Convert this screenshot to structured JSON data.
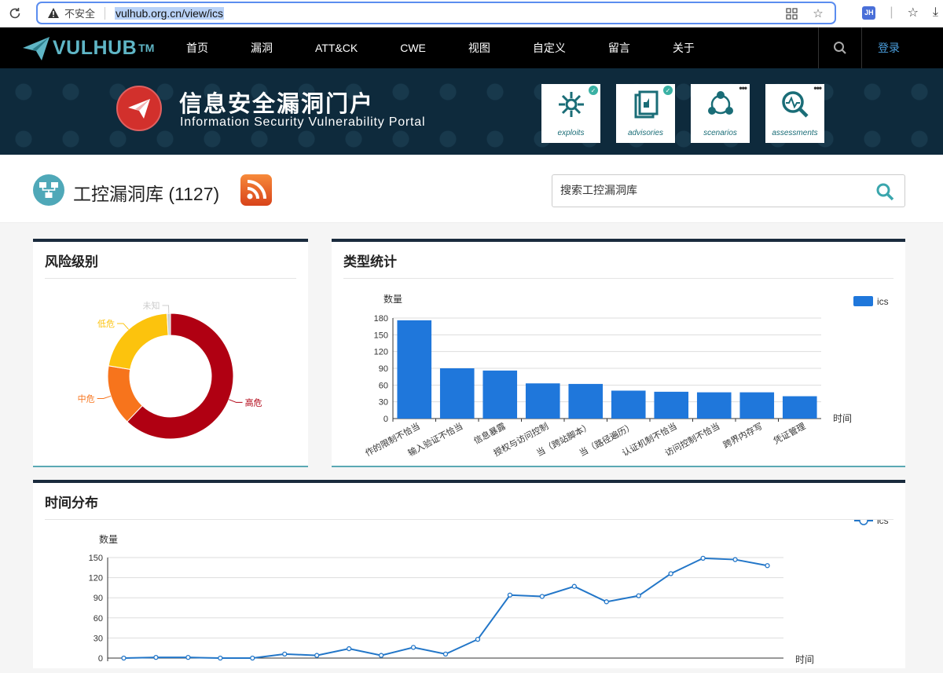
{
  "browser": {
    "insecure_label": "不安全",
    "url": "vulhub.org.cn/view/ics",
    "profile_badge": "JH"
  },
  "nav": {
    "logo_text": "VULHUB",
    "logo_tm": "TM",
    "items": [
      "首页",
      "漏洞",
      "ATT&CK",
      "CWE",
      "视图",
      "自定义",
      "留言",
      "关于"
    ],
    "login": "登录"
  },
  "banner": {
    "title_cn": "信息安全漏洞门户",
    "title_en": "Information Security Vulnerability Portal",
    "tiles": [
      {
        "label": "exploits",
        "badge": "check"
      },
      {
        "label": "advisories",
        "badge": "check"
      },
      {
        "label": "scenarios",
        "badge": "more"
      },
      {
        "label": "assessments",
        "badge": "more"
      }
    ]
  },
  "page": {
    "title": "工控漏洞库 (1127)",
    "search_placeholder": "搜索工控漏洞库"
  },
  "panels": {
    "risk_title": "风险级别",
    "type_title": "类型统计",
    "time_title": "时间分布"
  },
  "colors": {
    "high": "#b00012",
    "medium": "#f7741c",
    "low": "#fcc30d",
    "unknown": "#cccccc",
    "bar": "#1f77db",
    "line": "#2276c8"
  },
  "chart_data": [
    {
      "type": "pie",
      "title": "风险级别",
      "donut": true,
      "labels": [
        "高危",
        "中危",
        "低危",
        "未知"
      ],
      "values": [
        700,
        175,
        242,
        10
      ]
    },
    {
      "type": "bar",
      "title": "类型统计",
      "categories": [
        "操作的限制不恰当",
        "输入验证不恰当",
        "信息暴露",
        "授权与访问控制",
        "跨站脚本",
        "路径遍历",
        "认证机制不恰当",
        "访问控制不恰当",
        "跨界内存写",
        "凭证管理"
      ],
      "category_labels_visible": [
        "作的限制不恰当",
        "输入验证不恰当",
        "信息暴露",
        "授权与访问控制",
        "当（跨站脚本）",
        "当（路径遍历）",
        "认证机制不恰当",
        "访问控制不恰当",
        "跨界内存写",
        "凭证管理"
      ],
      "series": [
        {
          "name": "ics",
          "values": [
            176,
            90,
            86,
            63,
            62,
            50,
            48,
            47,
            47,
            40
          ]
        }
      ],
      "xlabel": "时间",
      "ylabel": "数量",
      "ylim": [
        0,
        180
      ],
      "yticks": [
        0,
        30,
        60,
        90,
        120,
        150,
        180
      ],
      "legend": "top-right",
      "grid": true
    },
    {
      "type": "line",
      "title": "时间分布",
      "series": [
        {
          "name": "ics",
          "values": [
            0,
            1,
            1,
            0,
            0,
            6,
            4,
            14,
            4,
            16,
            6,
            28,
            94,
            92,
            107,
            84,
            93,
            126,
            149,
            147,
            138
          ]
        }
      ],
      "xlabel": "时间",
      "ylabel": "数量",
      "ylim": [
        0,
        150
      ],
      "yticks": [
        0,
        30,
        60,
        90,
        120,
        150
      ],
      "legend": "top-right",
      "grid": true
    }
  ]
}
